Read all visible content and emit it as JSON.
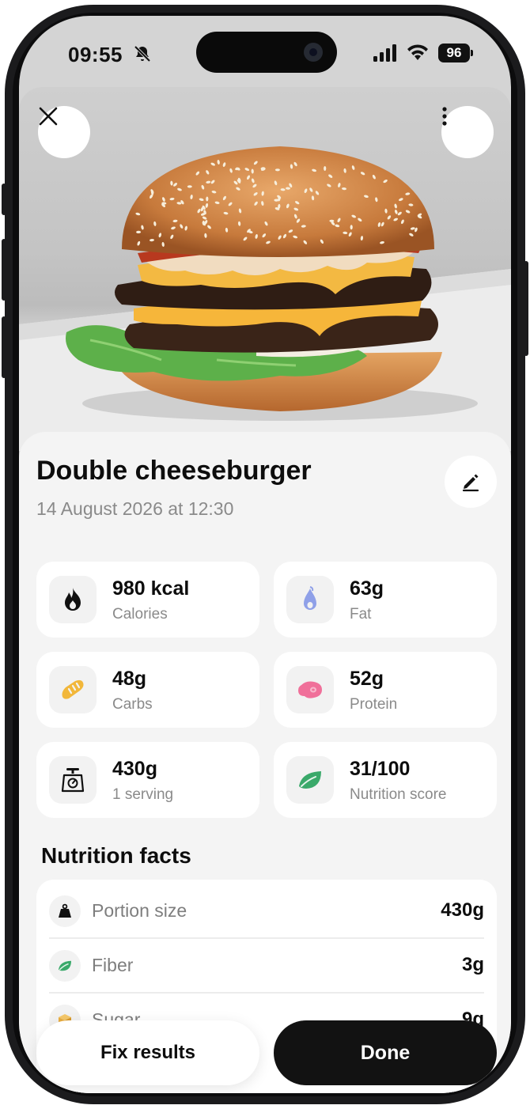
{
  "status_bar": {
    "time": "09:55",
    "battery": "96"
  },
  "food": {
    "name": "Double cheeseburger",
    "timestamp": "14 August 2026 at 12:30",
    "image_alt": "double cheeseburger photo"
  },
  "stats": [
    {
      "value": "980 kcal",
      "label": "Calories",
      "icon": "flame-icon"
    },
    {
      "value": "63g",
      "label": "Fat",
      "icon": "fat-drop-icon"
    },
    {
      "value": "48g",
      "label": "Carbs",
      "icon": "bread-icon"
    },
    {
      "value": "52g",
      "label": "Protein",
      "icon": "meat-icon"
    },
    {
      "value": "430g",
      "label": "1 serving",
      "icon": "scale-icon"
    },
    {
      "value": "31/100",
      "label": "Nutrition score",
      "icon": "leaf-icon"
    }
  ],
  "nutrition": {
    "title": "Nutrition facts",
    "rows": [
      {
        "label": "Portion size",
        "value": "430g",
        "icon": "weight-icon"
      },
      {
        "label": "Fiber",
        "value": "3g",
        "icon": "leaf-icon"
      },
      {
        "label": "Sugar",
        "value": "9g",
        "icon": "sugar-cube-icon"
      }
    ]
  },
  "actions": {
    "fix": "Fix results",
    "done": "Done"
  },
  "colors": {
    "flame": "#111111",
    "fat": "#8fa0e8",
    "carbs": "#f2b73a",
    "protein": "#f0709a",
    "score": "#3aa96a",
    "sheet_bg": "#f4f4f4"
  }
}
